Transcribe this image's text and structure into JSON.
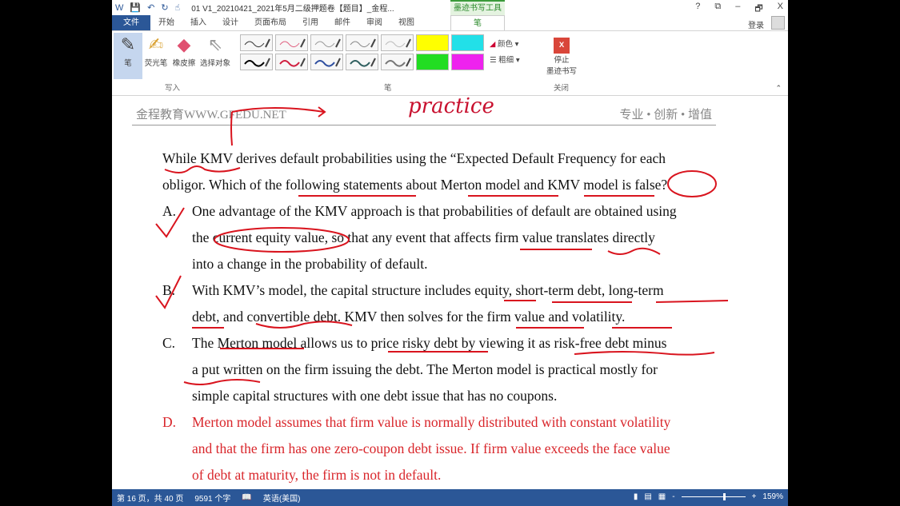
{
  "titlebar": {
    "title": "01 V1_20210421_2021年5月二级押题卷【题目】_金程...",
    "context_tab": "墨迹书写工具",
    "help": "?",
    "restore": "⧉",
    "minimize": "–",
    "maximize": "🗗",
    "close": "X"
  },
  "tabs": [
    "文件",
    "开始",
    "插入",
    "设计",
    "页面布局",
    "引用",
    "邮件",
    "审阅",
    "视图"
  ],
  "active_tab": "笔",
  "login": "登录",
  "ribbon": {
    "write_group": {
      "label": "写入",
      "tools": [
        "笔",
        "荧光笔",
        "橡皮擦",
        "选择对象"
      ]
    },
    "pen_group": {
      "label": "笔",
      "color": "颜色",
      "thickness": "粗细"
    },
    "close_group": {
      "label": "关闭",
      "stop": "停止",
      "stop2": "墨迹书写"
    }
  },
  "pens": [
    "#333",
    "#e06080",
    "#999",
    "#888",
    "#bbb",
    "#ffff00",
    "#22e0e8",
    "#000",
    "#d02040",
    "#3050a0",
    "#306060",
    "#777",
    "#22dd22",
    "#ee22ee"
  ],
  "document": {
    "header_left": "金程教育WWW.GFEDU.NET",
    "header_right": "专业 • 创新 • 增值",
    "handwriting": "practice",
    "question": [
      "While KMV derives default probabilities using the “Expected Default Frequency for each",
      "obligor. Which of the following statements about Merton model and KMV model is false?"
    ],
    "options": [
      {
        "letter": "A.",
        "lines": [
          "One advantage of the KMV approach is that probabilities of default are obtained using",
          "the current equity value, so that any event that affects firm value translates directly",
          "into a change in the probability of default."
        ]
      },
      {
        "letter": "B.",
        "lines": [
          "With KMV’s model, the capital structure includes equity, short-term debt, long-term",
          "debt, and convertible debt. KMV then solves for the firm value and volatility."
        ]
      },
      {
        "letter": "C.",
        "lines": [
          "The Merton model allows us to price risky debt by viewing it as risk-free debt minus",
          "a put written on the firm issuing the debt. The Merton model is practical mostly for",
          "simple capital structures with one debt issue that has no coupons."
        ]
      },
      {
        "letter": "D.",
        "lines": [
          "Merton model assumes that firm value is normally distributed with constant volatility",
          "and that the firm has one zero-coupon debt issue. If firm value exceeds the face value",
          "of debt at maturity, the firm is not in default."
        ]
      }
    ]
  },
  "status": {
    "page": "第 16 页，共 40 页",
    "words": "9591 个字",
    "language": "英语(美国)",
    "zoom": "159%"
  }
}
